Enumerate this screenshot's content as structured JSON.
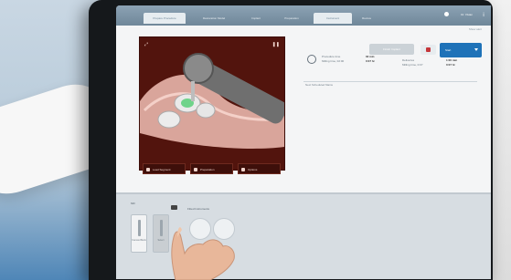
{
  "tabs": [
    {
      "label": "Prepare Procedure",
      "active": true
    },
    {
      "label": "Restoration Model",
      "active": false
    },
    {
      "label": "Implant",
      "active": false
    },
    {
      "label": "Preparation",
      "active": false
    },
    {
      "label": "Instrument",
      "active": true
    },
    {
      "label": "Review",
      "active": false
    }
  ],
  "header": {
    "user": "Dr. Vivian",
    "sub_link": "Show alert"
  },
  "viewer": {
    "buttons": [
      {
        "label": "Load Segment",
        "icon": "camera-icon"
      },
      {
        "label": "Preparation",
        "icon": "tooth-icon"
      },
      {
        "label": "Options",
        "icon": "options-icon"
      }
    ]
  },
  "panel": {
    "col1_label": "Procedure time",
    "col1_sub": "Milling time, 02:00",
    "col1_value1": "02 min",
    "col1_value2": "0:07 hr",
    "col2_label": "Deliveries",
    "col2_sub": "Milling time, 0:07",
    "col2_value1": "1:00 min",
    "col2_value2": "0:07 hr",
    "note": "Next Scheduled Mains"
  },
  "actions": {
    "options_label": "Finish Implant",
    "primary_label": "Start"
  },
  "bottom": {
    "tools_title": "Mill",
    "tools": [
      {
        "label": "Canvas Blank"
      },
      {
        "label": "Select"
      }
    ],
    "instruments_title": "Fitted Instruments"
  },
  "colors": {
    "accent": "#1e72b8",
    "viewer_bg": "#52140d",
    "topbar": "#7b92a5"
  }
}
